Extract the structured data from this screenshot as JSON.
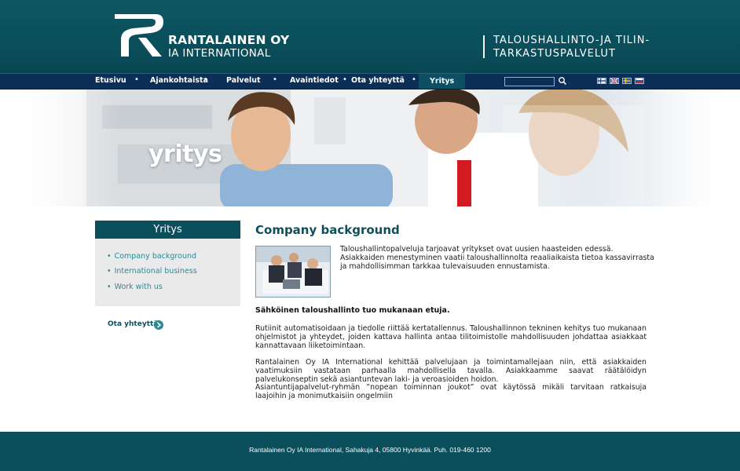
{
  "header": {
    "company_name": "RANTALAINEN OY",
    "company_sub": "IA INTERNATIONAL",
    "tagline_line1": "TALOUSHALLINTO-JA TILIN-",
    "tagline_line2": "TARKASTUSPALVELUT"
  },
  "nav": {
    "items": [
      "Etusivu",
      "Ajankohtaista",
      "Palvelut",
      "Avaintiedot",
      "Ota yhteyttä",
      "Yritys"
    ],
    "active": "Yritys",
    "search_value": ""
  },
  "hero": {
    "title": "yritys"
  },
  "sidebar": {
    "title": "Yritys",
    "links": [
      "Company background",
      "International business",
      "Work with us"
    ],
    "contact": "Ota yhteyttä"
  },
  "main": {
    "title": "Company background",
    "intro": "Taloushallintopalveluja tarjoavat yritykset ovat uusien haasteiden edessä. Asiakkaiden menestyminen vaatii taloushallinnolta reaaliaikaista tietoa kassavirrasta ja mahdollisimman tarkkaa tulevaisuuden ennustamista.",
    "bold_line": "Sähköinen taloushallinto tuo mukanaan etuja.",
    "para1": "Rutiinit automatisoidaan ja tiedolle riittää kertatallennus. Taloushallinnon tekninen kehitys tuo mukanaan ohjelmistot ja yhteydet, joiden kattava hallinta antaa tilitoimistolle mahdollisuuden johdattaa asiakkaat kannattavaan liiketoimintaan.",
    "para2": "Rantalainen Oy IA International kehittää palvelujaan ja toimintamallejaan niin, että asiakkaiden vaatimuksiin vastataan parhaalla mahdollisella tavalla. Asiakkaamme saavat räätälöidyn palvelukonseptin sekä asiantuntevan laki- ja veroasioiden hoidon.",
    "para3": "Asiantuntijapalvelut-ryhmän ”nopean toiminnan joukot” ovat käytössä mikäli tarvitaan ratkaisuja laajoihin ja monimutkaisiin ongelmiin"
  },
  "footer": {
    "text": "Rantalainen Oy IA International, Sahakuja 4, 05800 Hyvinkää. Puh. 019-460 1200"
  },
  "colors": {
    "header_bg": "#0b4f5b",
    "nav_bg": "#0b2f56",
    "accent_link": "#2a8a96",
    "footer_bg": "#0b4e5c"
  },
  "icons": {
    "logo": "r-logo-icon",
    "search": "search-icon",
    "flags": [
      "finland-flag-icon",
      "uk-flag-icon",
      "sweden-flag-icon",
      "russia-flag-icon"
    ],
    "contact": "arrow-circle-icon"
  }
}
